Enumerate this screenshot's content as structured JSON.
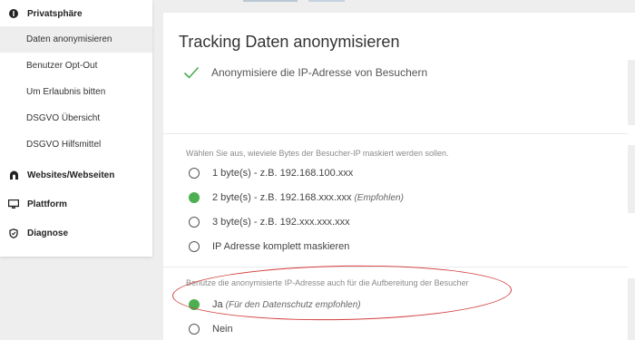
{
  "sidebar": {
    "privacy": {
      "label": "Privatsphäre",
      "icon": "privacy-icon"
    },
    "privacy_items": [
      {
        "label": "Daten anonymisieren",
        "active": true
      },
      {
        "label": "Benutzer Opt-Out",
        "active": false
      },
      {
        "label": "Um Erlaubnis bitten",
        "active": false
      },
      {
        "label": "DSGVO Übersicht",
        "active": false
      },
      {
        "label": "DSGVO Hilfsmittel",
        "active": false
      }
    ],
    "websites": {
      "label": "Websites/Webseiten",
      "icon": "websites-icon"
    },
    "platform": {
      "label": "Plattform",
      "icon": "monitor-icon"
    },
    "diagnose": {
      "label": "Diagnose",
      "icon": "shield-icon"
    }
  },
  "main": {
    "title": "Tracking Daten anonymisieren",
    "ip_anonymize": {
      "label": "Anonymisiere die IP-Adresse von Besuchern",
      "checked": true
    },
    "mask_question": "Wählen Sie aus, wieviele Bytes der Besucher-IP maskiert werden sollen.",
    "mask_options": [
      {
        "label": "1 byte(s) - z.B. 192.168.100.xxx",
        "note": "",
        "selected": false
      },
      {
        "label": "2 byte(s) - z.B. 192.168.xxx.xxx",
        "note": "(Empfohlen)",
        "selected": true
      },
      {
        "label": "3 byte(s) - z.B. 192.xxx.xxx.xxx",
        "note": "",
        "selected": false
      },
      {
        "label": "IP Adresse komplett maskieren",
        "note": "",
        "selected": false
      }
    ],
    "enrichment_question": "Benutze die anonymisierte IP-Adresse auch für die Aufbereitung der Besucher",
    "enrichment_options": [
      {
        "label": "Ja",
        "note": "(Für den Datenschutz empfohlen)",
        "selected": true
      },
      {
        "label": "Nein",
        "note": "",
        "selected": false
      }
    ]
  },
  "colors": {
    "accent_green": "#4caf50",
    "annotation_red": "#d23b3b"
  }
}
